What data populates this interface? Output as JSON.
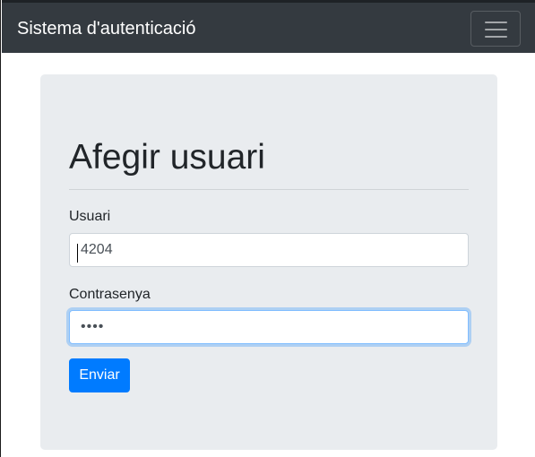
{
  "navbar": {
    "brand": "Sistema d'autenticació",
    "toggler_icon": "hamburger-menu-icon"
  },
  "form": {
    "title": "Afegir usuari",
    "username": {
      "label": "Usuari",
      "value": "4204"
    },
    "password": {
      "label": "Contrasenya",
      "value": "4204",
      "focused": true
    },
    "submit_label": "Enviar"
  },
  "colors": {
    "navbar_bg": "#343a40",
    "panel_bg": "#e9ecef",
    "primary": "#007bff",
    "focus_border": "#80bdff"
  }
}
